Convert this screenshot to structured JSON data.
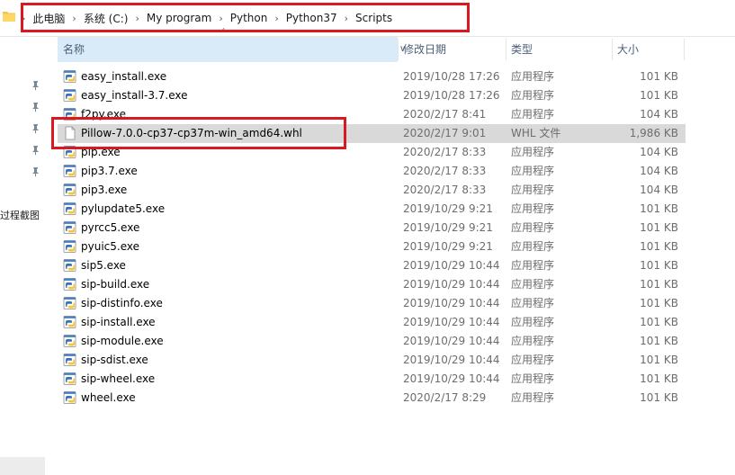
{
  "breadcrumb": [
    "此电脑",
    "系统 (C:)",
    "My program",
    "Python",
    "Python37",
    "Scripts"
  ],
  "columns": {
    "name": "名称",
    "date": "修改日期",
    "type": "类型",
    "size": "大小"
  },
  "left_pane": {
    "label": "过程截图"
  },
  "files": [
    {
      "name": "easy_install.exe",
      "date": "2019/10/28 17:26",
      "type": "应用程序",
      "size": "101 KB",
      "icon": "python-exe-icon"
    },
    {
      "name": "easy_install-3.7.exe",
      "date": "2019/10/28 17:26",
      "type": "应用程序",
      "size": "101 KB",
      "icon": "python-exe-icon"
    },
    {
      "name": "f2py.exe",
      "date": "2020/2/17 8:41",
      "type": "应用程序",
      "size": "104 KB",
      "icon": "python-exe-icon"
    },
    {
      "name": "Pillow-7.0.0-cp37-cp37m-win_amd64.whl",
      "date": "2020/2/17 9:01",
      "type": "WHL 文件",
      "size": "1,986 KB",
      "icon": "blank-file-icon",
      "selected": true
    },
    {
      "name": "pip.exe",
      "date": "2020/2/17 8:33",
      "type": "应用程序",
      "size": "104 KB",
      "icon": "python-exe-icon"
    },
    {
      "name": "pip3.7.exe",
      "date": "2020/2/17 8:33",
      "type": "应用程序",
      "size": "104 KB",
      "icon": "python-exe-icon"
    },
    {
      "name": "pip3.exe",
      "date": "2020/2/17 8:33",
      "type": "应用程序",
      "size": "104 KB",
      "icon": "python-exe-icon"
    },
    {
      "name": "pylupdate5.exe",
      "date": "2019/10/29 9:21",
      "type": "应用程序",
      "size": "101 KB",
      "icon": "python-exe-icon"
    },
    {
      "name": "pyrcc5.exe",
      "date": "2019/10/29 9:21",
      "type": "应用程序",
      "size": "101 KB",
      "icon": "python-exe-icon"
    },
    {
      "name": "pyuic5.exe",
      "date": "2019/10/29 9:21",
      "type": "应用程序",
      "size": "101 KB",
      "icon": "python-exe-icon"
    },
    {
      "name": "sip5.exe",
      "date": "2019/10/29 10:44",
      "type": "应用程序",
      "size": "101 KB",
      "icon": "python-exe-icon"
    },
    {
      "name": "sip-build.exe",
      "date": "2019/10/29 10:44",
      "type": "应用程序",
      "size": "101 KB",
      "icon": "python-exe-icon"
    },
    {
      "name": "sip-distinfo.exe",
      "date": "2019/10/29 10:44",
      "type": "应用程序",
      "size": "101 KB",
      "icon": "python-exe-icon"
    },
    {
      "name": "sip-install.exe",
      "date": "2019/10/29 10:44",
      "type": "应用程序",
      "size": "101 KB",
      "icon": "python-exe-icon"
    },
    {
      "name": "sip-module.exe",
      "date": "2019/10/29 10:44",
      "type": "应用程序",
      "size": "101 KB",
      "icon": "python-exe-icon"
    },
    {
      "name": "sip-sdist.exe",
      "date": "2019/10/29 10:44",
      "type": "应用程序",
      "size": "101 KB",
      "icon": "python-exe-icon"
    },
    {
      "name": "sip-wheel.exe",
      "date": "2019/10/29 10:44",
      "type": "应用程序",
      "size": "101 KB",
      "icon": "python-exe-icon"
    },
    {
      "name": "wheel.exe",
      "date": "2020/2/17 8:29",
      "type": "应用程序",
      "size": "101 KB",
      "icon": "python-exe-icon"
    }
  ],
  "colors": {
    "highlight_box": "#d9191f",
    "selected_row": "#d9d9d9",
    "header_active": "#d9ebf9",
    "header_text": "#4c607a"
  }
}
